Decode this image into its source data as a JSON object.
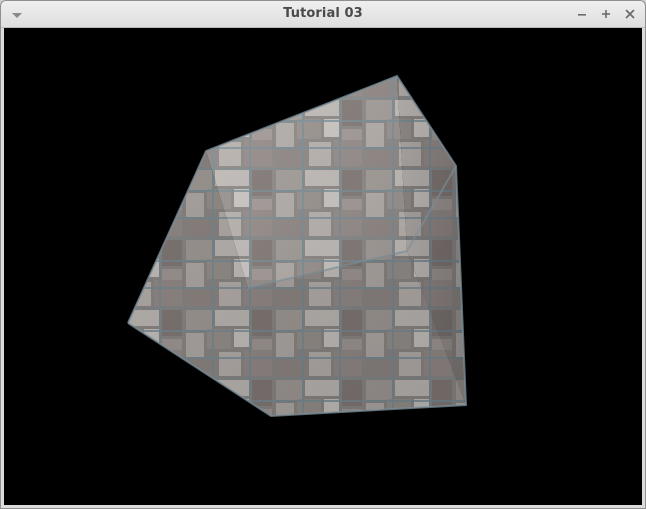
{
  "window": {
    "title": "Tutorial 03",
    "controls": {
      "minimize": "–",
      "maximize": "+",
      "close": "×"
    },
    "menu_icon": "chevron-down-icon"
  },
  "viewport": {
    "background": "#000000",
    "object": "textured-cube",
    "texture": "stone-brick"
  }
}
